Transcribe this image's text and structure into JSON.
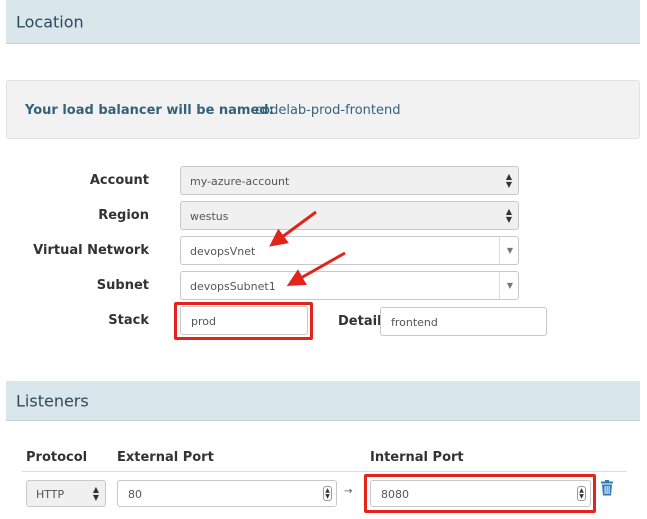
{
  "sections": {
    "location_title": "Location",
    "listeners_title": "Listeners"
  },
  "naming": {
    "label": "Your load balancer will be named:",
    "value": "codelab-prod-frontend"
  },
  "form": {
    "account": {
      "label": "Account",
      "value": "my-azure-account"
    },
    "region": {
      "label": "Region",
      "value": "westus"
    },
    "virtual_network": {
      "label": "Virtual Network",
      "value": "devopsVnet"
    },
    "subnet": {
      "label": "Subnet",
      "value": "devopsSubnet1"
    },
    "stack": {
      "label": "Stack",
      "value": "prod"
    },
    "detail": {
      "label": "Detail",
      "value": "frontend"
    }
  },
  "listeners": {
    "columns": [
      "Protocol",
      "External Port",
      "Internal Port"
    ],
    "rows": [
      {
        "protocol": "HTTP",
        "external_port": "80",
        "internal_port": "8080"
      }
    ],
    "arrow": "→"
  },
  "icons": {
    "select_spinner": "updown-spinner-icon",
    "dropdown": "caret-down-icon",
    "delete": "trash-icon",
    "annotation": "red-arrow-icon"
  },
  "colors": {
    "header_bg": "#d9e6ec",
    "header_text": "#2d4b5a",
    "name_text": "#35627b",
    "annotation_red": "#e3241b",
    "trash_blue": "#2b7bb9"
  }
}
